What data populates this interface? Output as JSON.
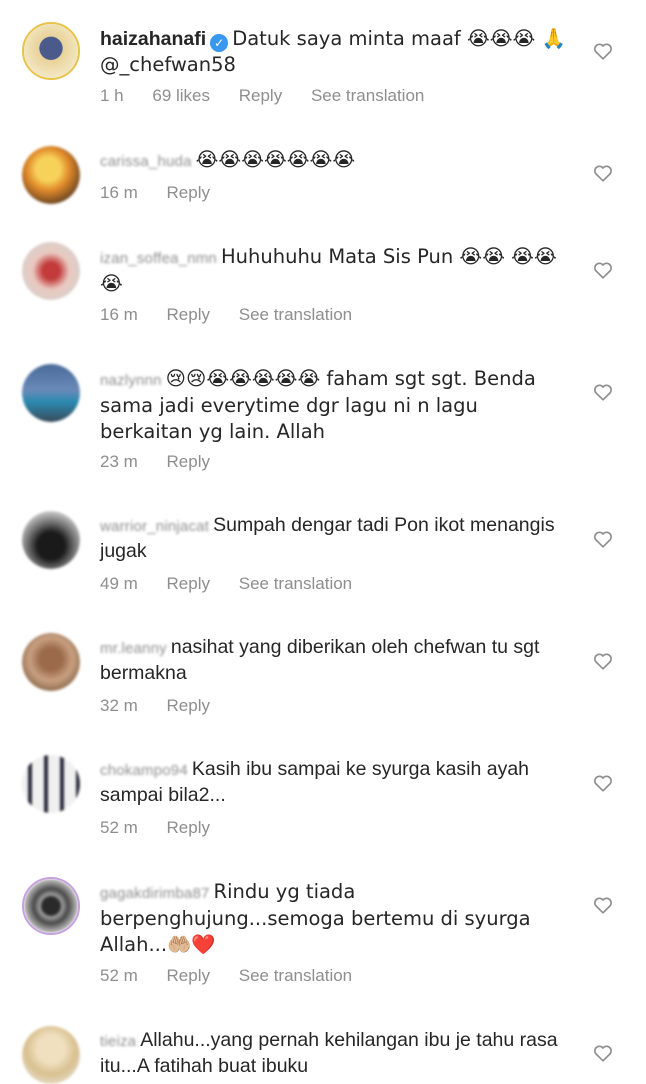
{
  "comments": [
    {
      "username": "haizahanafi",
      "verified": true,
      "text": "Datuk saya minta maaf 😭😭😭 🙏 @_chefwan58",
      "time": "1 h",
      "likes": "69 likes",
      "reply": "Reply",
      "translation": "See translation"
    },
    {
      "username": "carissa_huda",
      "text": "😭😭😭😭😭😭😭",
      "time": "16 m",
      "reply": "Reply"
    },
    {
      "username": "izan_soffea_nmn",
      "text": "Huhuhuhu Mata Sis Pun 😭😭 😭😭😭",
      "time": "16 m",
      "reply": "Reply",
      "translation": "See translation"
    },
    {
      "username": "nazlynnn",
      "text": "😢😢😭😭😭😭😭 faham sgt sgt. Benda sama jadi everytime dgr lagu ni n lagu berkaitan yg lain. Allah",
      "time": "23 m",
      "reply": "Reply"
    },
    {
      "username": "warrior_ninjacat",
      "text": "Sumpah dengar tadi Pon ikot menangis jugak",
      "time": "49 m",
      "reply": "Reply",
      "translation": "See translation"
    },
    {
      "username": "mr.leanny",
      "text": "nasihat yang diberikan oleh chefwan tu sgt bermakna",
      "time": "32 m",
      "reply": "Reply"
    },
    {
      "username": "chokampo94",
      "text": "Kasih ibu sampai ke syurga kasih ayah sampai bila2...",
      "time": "52 m",
      "reply": "Reply"
    },
    {
      "username": "gagakdirimba87",
      "text": "Rindu yg tiada berpenghujung...semoga bertemu di syurga Allah...🤲🏼❤️",
      "time": "52 m",
      "reply": "Reply",
      "translation": "See translation"
    },
    {
      "username": "tieiza",
      "text": "Allahu...yang pernah kehilangan ibu je tahu rasa itu...A fatihah buat ibuku"
    }
  ]
}
